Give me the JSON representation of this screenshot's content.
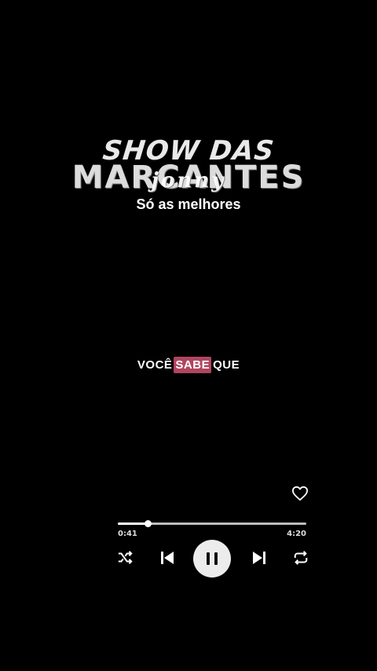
{
  "header": {
    "title_line1": "SHOW DAS",
    "title_line2": "MARCANTES",
    "signature": "jonny",
    "subtitle": "Só as melhores"
  },
  "lyrics": {
    "words": [
      "VOCÊ",
      "SABE",
      "QUE"
    ],
    "highlight_index": 1,
    "highlight_color": "#b0455e"
  },
  "player": {
    "elapsed": "0:41",
    "duration": "4:20",
    "progress_fraction": 0.16,
    "liked": false,
    "state": "playing",
    "controls": [
      "shuffle-icon",
      "previous-icon",
      "pause-icon",
      "next-icon",
      "repeat-icon"
    ]
  }
}
